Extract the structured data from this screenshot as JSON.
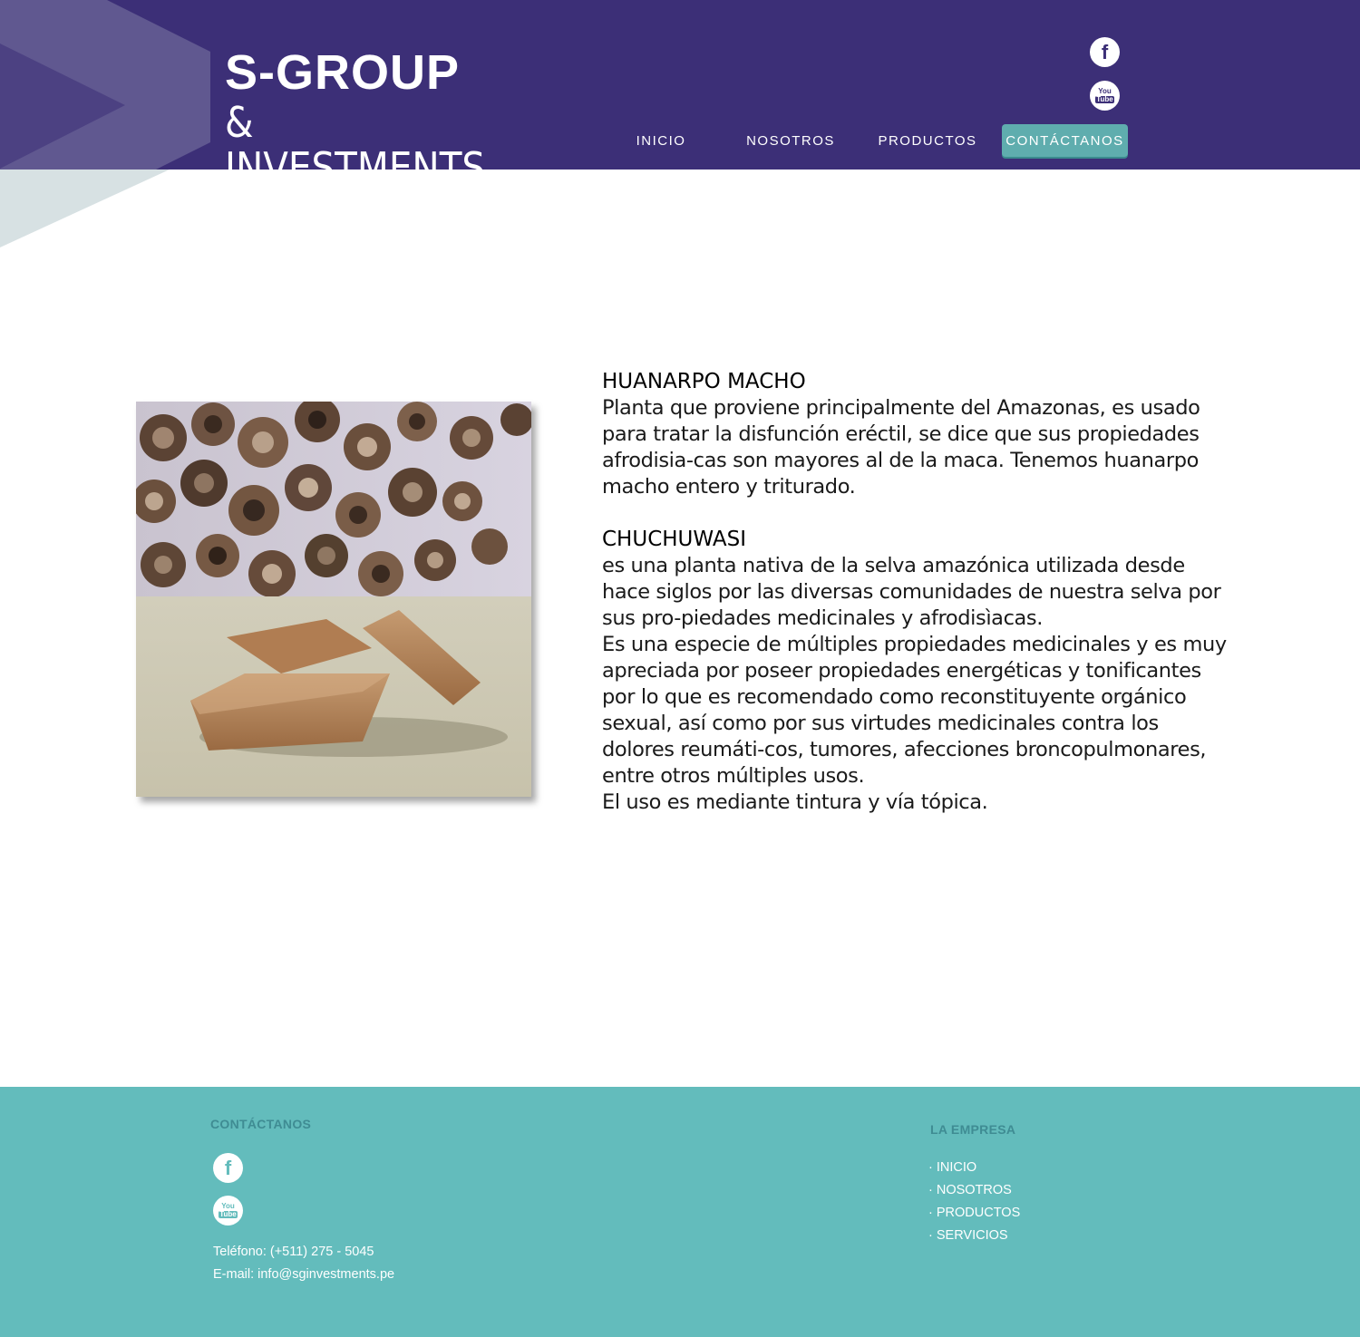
{
  "brand": {
    "line1": "S-GROUP",
    "line2": "& INVESTMENTS"
  },
  "header": {
    "social": {
      "facebook_icon": "facebook-icon",
      "youtube_icon": "youtube-icon",
      "youtube_text_top": "You",
      "youtube_text_bottom": "Tube"
    },
    "nav": [
      {
        "label": "INICIO"
      },
      {
        "label": "NOSOTROS"
      },
      {
        "label": "PRODUCTOS"
      },
      {
        "label": "CONTÁCTANOS",
        "active": true
      }
    ]
  },
  "products": [
    {
      "title": "HUANARPO MACHO",
      "paragraphs": [
        "Planta que proviene principalmente del Amazonas, es usado para tratar la disfunción eréctil, se dice que sus propiedades afrodisia-cas son mayores al de la maca. Tenemos huanarpo macho entero y triturado."
      ]
    },
    {
      "title": "CHUCHUWASI",
      "paragraphs": [
        "es una planta nativa de la selva amazónica utilizada desde hace siglos por las diversas comunidades de nuestra selva por sus pro-piedades medicinales y afrodisìacas.",
        "Es una especie de múltiples propiedades medicinales y es muy apreciada por poseer propiedades energéticas y tonificantes por lo que es recomendado como reconstituyente orgánico sexual, así como por sus virtudes medicinales contra los dolores reumáti-cos, tumores, afecciones broncopulmonares, entre otros múltiples usos.",
        "El uso es mediante tintura y vía tópica."
      ]
    }
  ],
  "footer": {
    "contact_title": "CONTÁCTANOS",
    "phone": "Teléfono: (+511) 275 - 5045",
    "email": "E-mail: info@sginvestments.pe",
    "company_title": "LA EMPRESA",
    "links": [
      "· INICIO",
      "· NOSOTROS",
      "· PRODUCTOS",
      "· SERVICIOS"
    ]
  },
  "colors": {
    "header_bg": "#3c2f77",
    "accent_teal": "#5fadae",
    "footer_bg": "#63bcbc",
    "footer_title": "#3f8c93"
  }
}
